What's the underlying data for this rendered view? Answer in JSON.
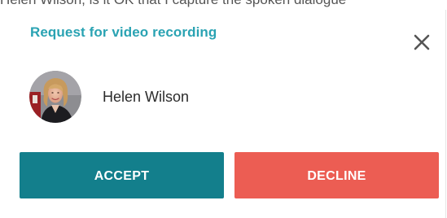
{
  "background_text": "Helen Wilson, is it OK that I capture the spoken dialogue",
  "dialog": {
    "title": "Request for video recording",
    "close_icon": "close-icon",
    "user": {
      "name": "Helen Wilson",
      "avatar": "avatar-photo"
    },
    "buttons": {
      "accept_label": "ACCEPT",
      "decline_label": "DECLINE"
    }
  },
  "colors": {
    "title": "#2aa3b3",
    "accept": "#137f8c",
    "decline": "#ec5d53",
    "close_icon": "#555555"
  }
}
